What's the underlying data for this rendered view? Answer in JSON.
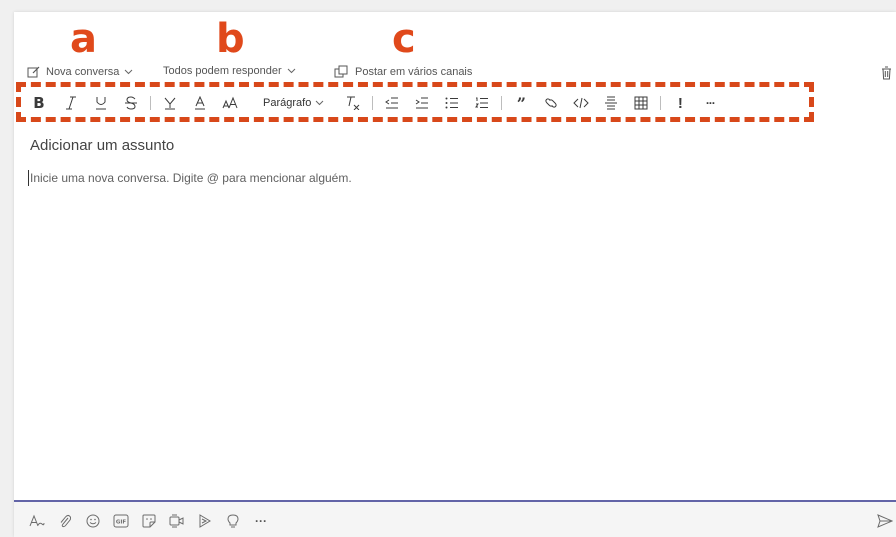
{
  "annotations": {
    "a": "a",
    "b": "b",
    "c": "c"
  },
  "toolbar": {
    "new_conversation": "Nova conversa",
    "reply_mode": "Todos podem responder",
    "post_multiple": "Postar em vários canais",
    "paragraph": "Parágrafo",
    "more": "···"
  },
  "editor": {
    "subject_placeholder": "Adicionar um assunto",
    "message_placeholder": "Inicie uma nova conversa. Digite @ para mencionar alguém."
  },
  "bottom": {
    "more": "···"
  },
  "colors": {
    "accent": "#6264a7",
    "callout": "#e0491b"
  }
}
